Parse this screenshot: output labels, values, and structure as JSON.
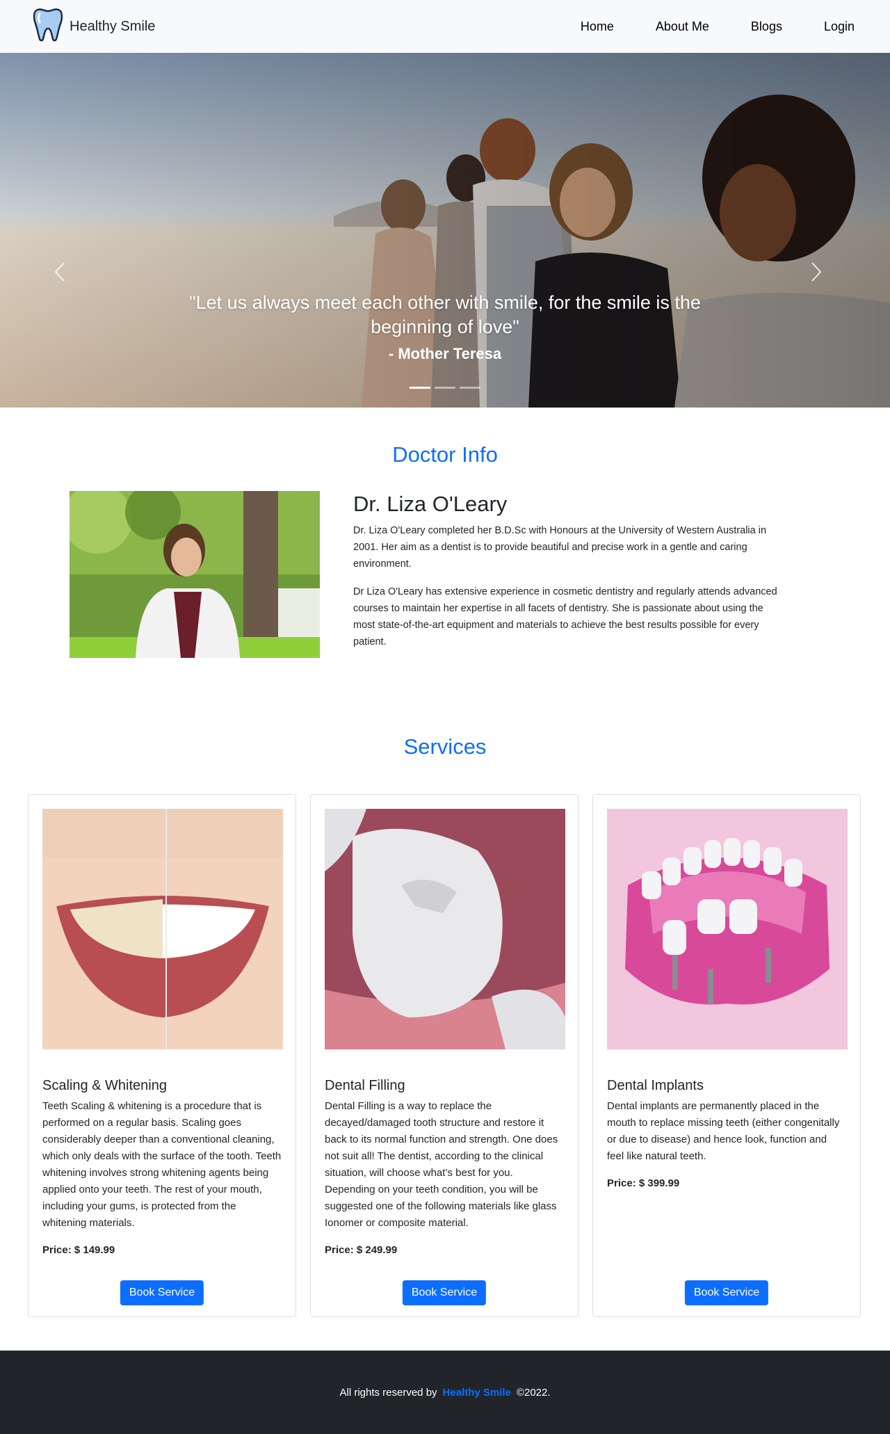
{
  "brand": {
    "name": "Healthy Smile",
    "icon": "tooth-icon"
  },
  "nav": [
    {
      "label": "Home"
    },
    {
      "label": "About Me"
    },
    {
      "label": "Blogs"
    },
    {
      "label": "Login"
    }
  ],
  "hero": {
    "quote": "\"Let us always meet each other with smile, for the smile is the beginning of love\"",
    "author": "- Mother Teresa",
    "slides": 3,
    "active_slide": 1
  },
  "doctor": {
    "section_title": "Doctor Info",
    "name": "Dr. Liza O'Leary",
    "paragraphs": [
      "Dr. Liza O'Leary completed her B.D.Sc with Honours at the University of Western Australia in 2001. Her aim as a dentist is to provide beautiful and precise work in a gentle and caring environment.",
      "Dr Liza O'Leary has extensive experience in cosmetic dentistry and regularly attends advanced courses to maintain her expertise in all facets of dentistry. She is passionate about using the most state-of-the-art equipment and materials to achieve the best results possible for every patient."
    ]
  },
  "services": {
    "section_title": "Services",
    "items": [
      {
        "title": "Scaling & Whitening",
        "description": "Teeth Scaling & whitening is a procedure that is performed on a regular basis. Scaling goes considerably deeper than a conventional cleaning, which only deals with the surface of the tooth. Teeth whitening involves strong whitening agents being applied onto your teeth. The rest of your mouth, including your gums, is protected from the whitening materials.",
        "price": "Price: $ 149.99",
        "button": "Book Service"
      },
      {
        "title": "Dental Filling",
        "description": "Dental Filling is a way to replace the decayed/damaged tooth structure and restore it back to its normal function and strength. One does not suit all! The dentist, according to the clinical situation, will choose what’s best for you. Depending on your teeth condition, you will be suggested one of the following materials like glass Ionomer or composite material.",
        "price": "Price: $ 249.99",
        "button": "Book Service"
      },
      {
        "title": "Dental Implants",
        "description": "Dental implants are permanently placed in the mouth to replace missing teeth (either congenitally or due to disease) and hence look, function and feel like natural teeth.",
        "price": "Price: $ 399.99",
        "button": "Book Service"
      }
    ]
  },
  "footer": {
    "prefix": "All rights reserved by",
    "brand": "Healthy Smile",
    "suffix": "©2022."
  },
  "colors": {
    "primary": "#0d6efd",
    "footer_bg": "#212529",
    "navbar_bg": "#f8f9fa"
  }
}
